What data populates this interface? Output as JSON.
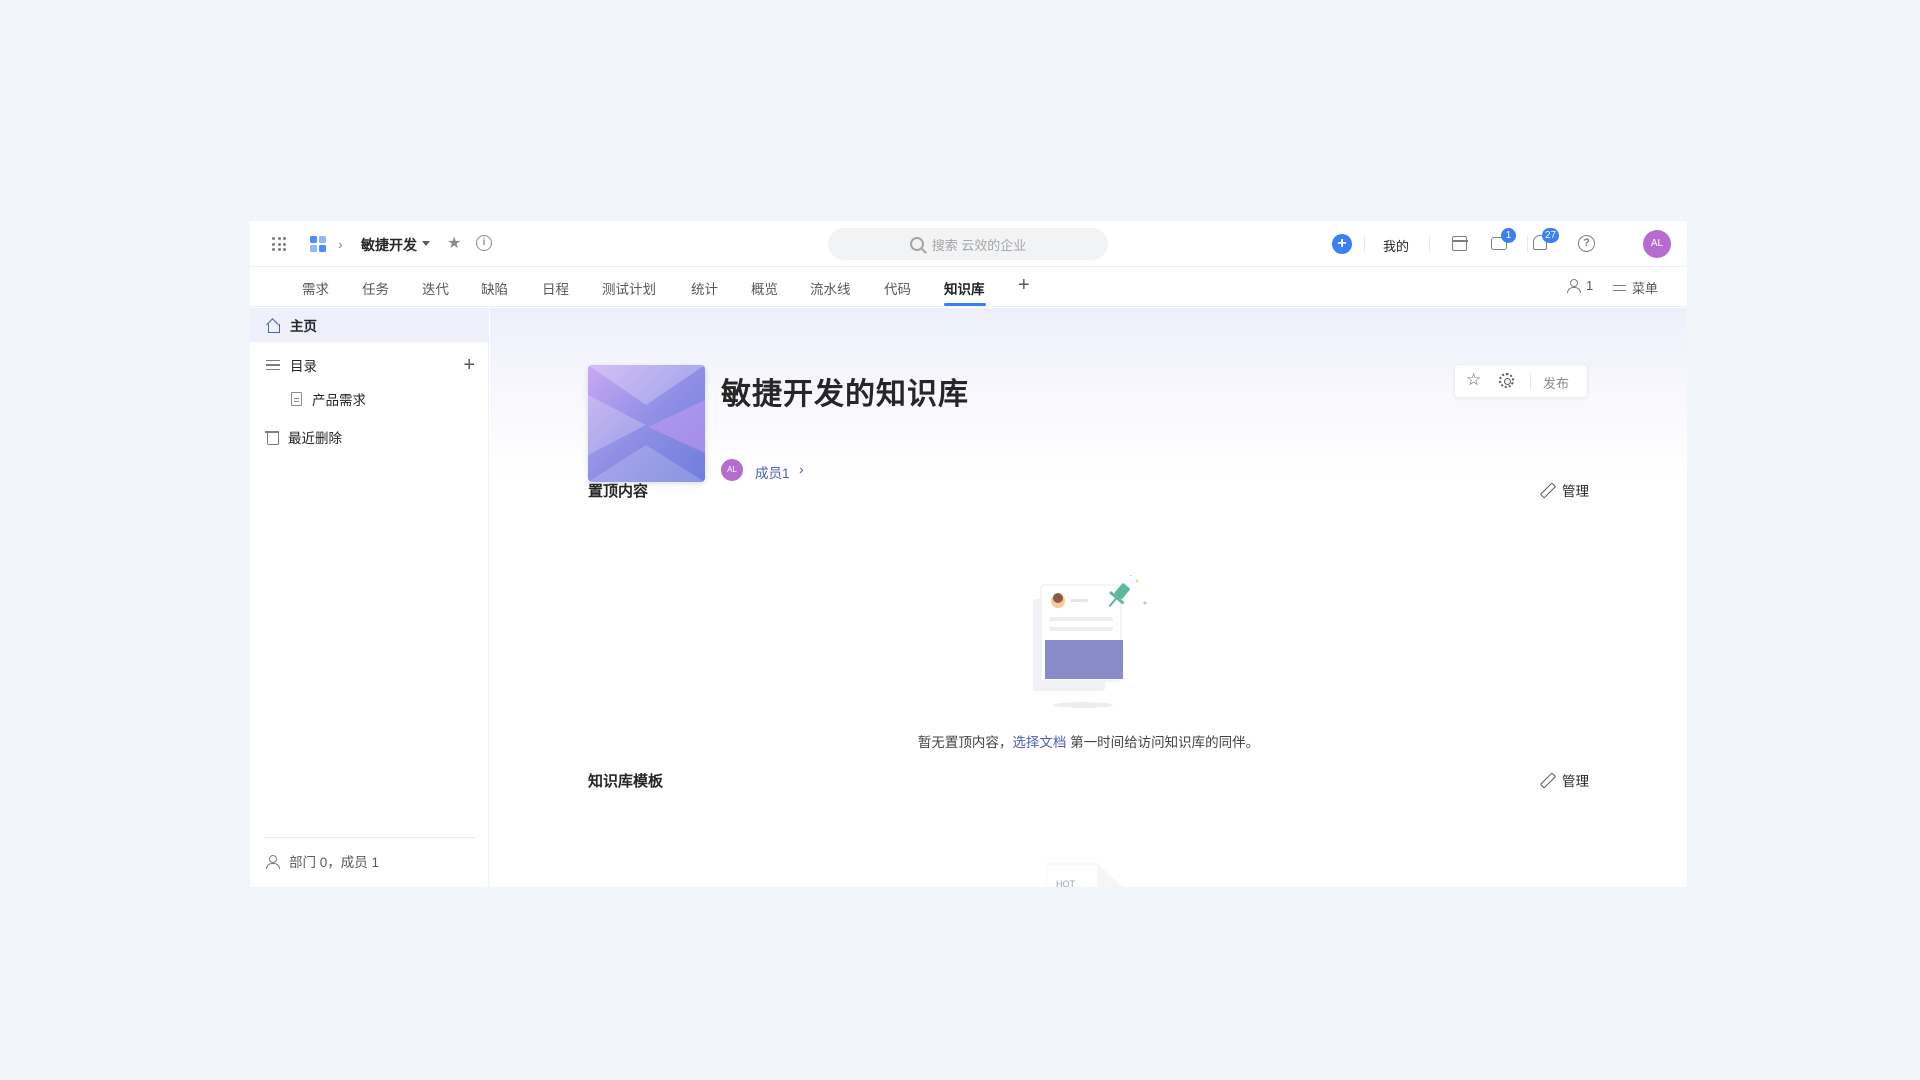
{
  "header": {
    "project_name": "敏捷开发",
    "search_placeholder": "搜索 云效的企业",
    "mine_label": "我的",
    "message_badge": "1",
    "notification_badge": "27",
    "avatar_text": "AL"
  },
  "nav": {
    "tabs": [
      {
        "label": "需求"
      },
      {
        "label": "任务"
      },
      {
        "label": "迭代"
      },
      {
        "label": "缺陷"
      },
      {
        "label": "日程"
      },
      {
        "label": "测试计划"
      },
      {
        "label": "统计"
      },
      {
        "label": "概览"
      },
      {
        "label": "流水线"
      },
      {
        "label": "代码"
      },
      {
        "label": "知识库"
      }
    ],
    "active_tab": "知识库",
    "members_count": "1",
    "menu_label": "菜单"
  },
  "sidebar": {
    "home": "主页",
    "catalog": "目录",
    "catalog_children": [
      {
        "label": "产品需求"
      }
    ],
    "recently_deleted": "最近删除",
    "footer": "部门 0，成员 1"
  },
  "main": {
    "title": "敏捷开发的知识库",
    "member_avatar": "AL",
    "member_link": "成员1",
    "publish": "发布",
    "pinned_title": "置顶内容",
    "manage_label": "管理",
    "empty_prefix": "暂无置顶内容，",
    "empty_link": "选择文档",
    "empty_suffix": " 第一时间给访问知识库的同伴。",
    "templates_title": "知识库模板",
    "template_peek_text": "HOT"
  },
  "colors": {
    "accent": "#3a7ff5",
    "link": "#4a5fc1",
    "avatar": "#b66bd1"
  }
}
